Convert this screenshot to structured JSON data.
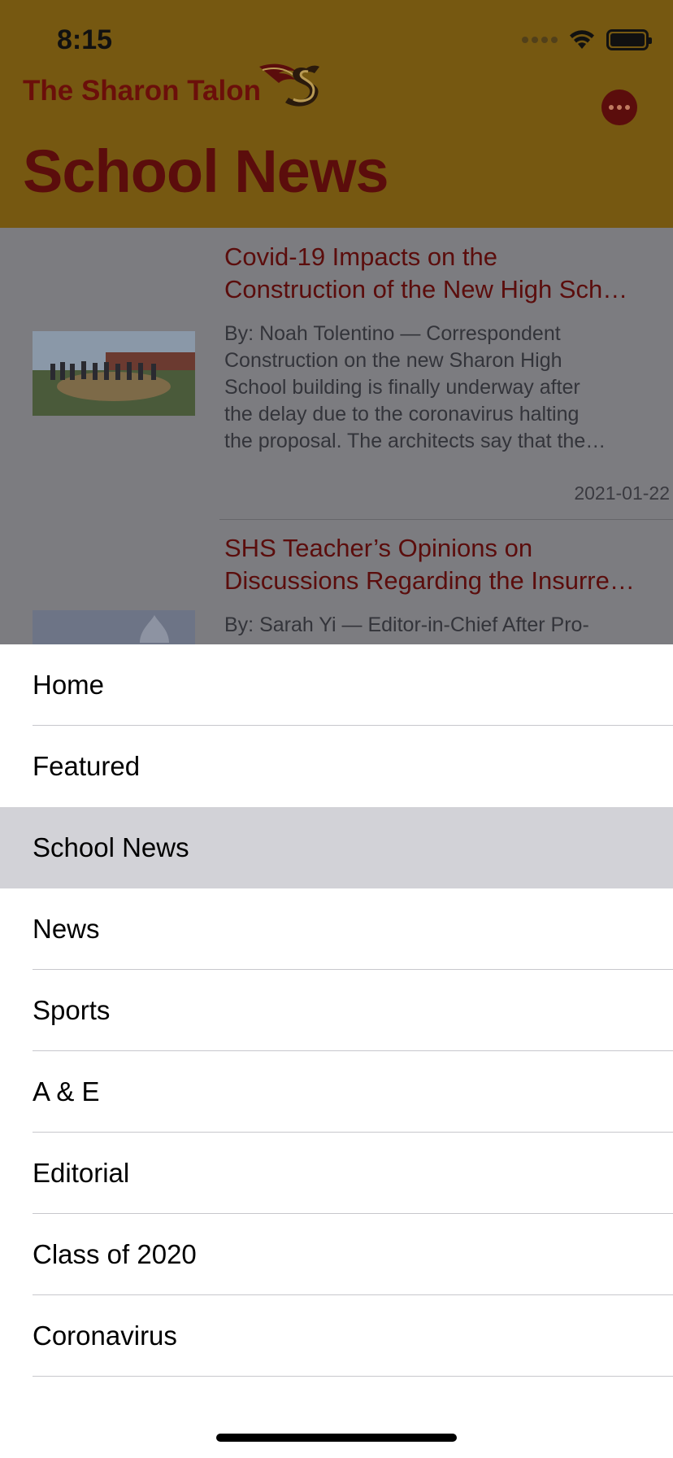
{
  "status_bar": {
    "time": "8:15"
  },
  "header": {
    "brand": "The Sharon Talon",
    "title": "School News",
    "colors": {
      "background": "#765811",
      "title": "#5b0d0c"
    }
  },
  "articles": [
    {
      "title": "Covid-19 Impacts on the Construction of the New High Sch…",
      "title_lines": [
        "Covid-19 Impacts on the",
        "Construction of the New High Sch…"
      ],
      "excerpt_lines": [
        "By: Noah Tolentino — Correspondent",
        "Construction on the new Sharon High",
        "School building is finally underway after",
        "the delay due to the coronavirus halting",
        "the proposal. The architects say that the…"
      ],
      "date": "2021-01-22"
    },
    {
      "title": "SHS Teacher’s Opinions on Discussions Regarding the Insurre…",
      "title_lines": [
        "SHS Teacher’s Opinions on",
        "Discussions Regarding the Insurre…"
      ],
      "excerpt_lines": [
        "By: Sarah Yi — Editor-in-Chief After Pro-"
      ]
    }
  ],
  "menu": {
    "items": [
      {
        "label": "Home"
      },
      {
        "label": "Featured"
      },
      {
        "label": "School News"
      },
      {
        "label": "News"
      },
      {
        "label": "Sports"
      },
      {
        "label": "A & E"
      },
      {
        "label": "Editorial"
      },
      {
        "label": "Class of 2020"
      },
      {
        "label": "Coronavirus"
      }
    ],
    "selected": "School News"
  }
}
